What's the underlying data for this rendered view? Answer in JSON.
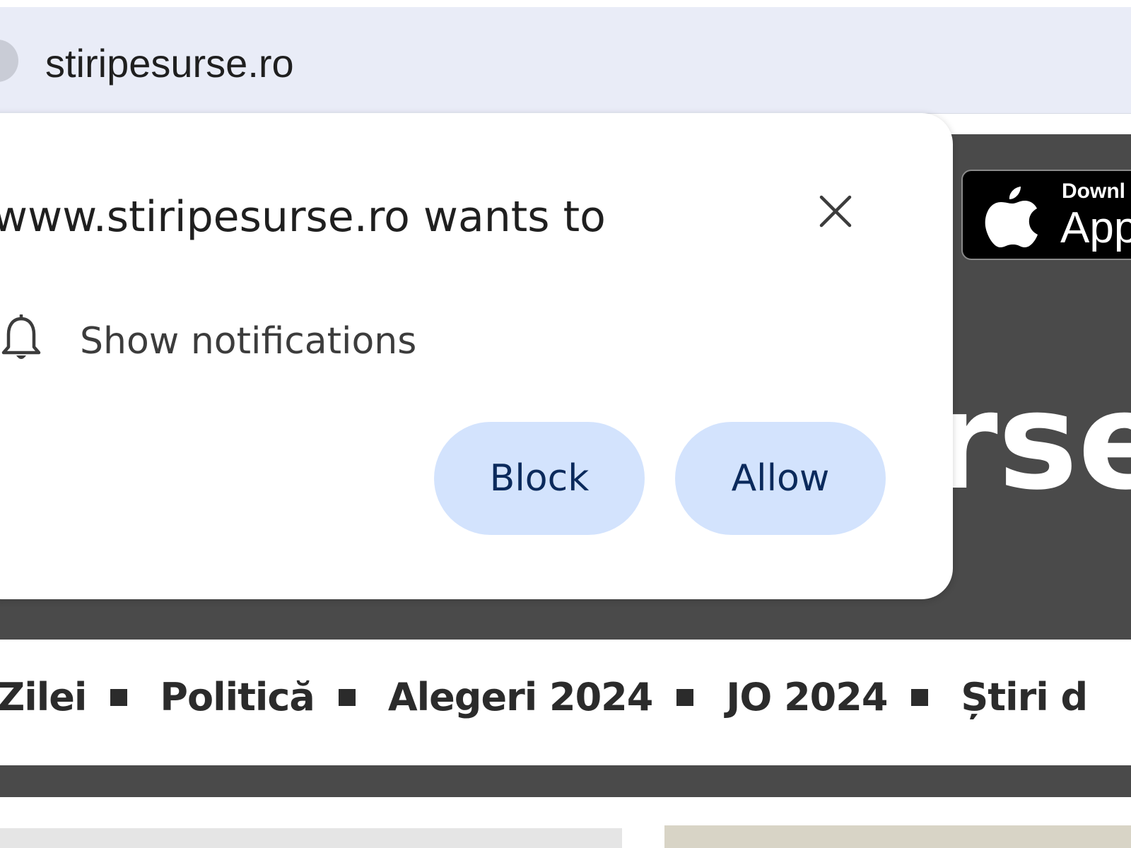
{
  "browser": {
    "url": "stiripesurse.ro"
  },
  "permission_prompt": {
    "title": "www.stiripesurse.ro wants to",
    "permission": "Show notifications",
    "block_label": "Block",
    "allow_label": "Allow",
    "button_bg_color": "#d3e3fd",
    "button_text_color": "#0b2a5c"
  },
  "site": {
    "header_bg_color": "#4a4a4a",
    "app_badge": {
      "small_text": "Downl",
      "big_text": "App"
    },
    "logo_fragment": "rse",
    "nav": [
      "rile Zilei",
      "Politică",
      "Alegeri 2024",
      "JO 2024",
      "Știri d"
    ]
  }
}
